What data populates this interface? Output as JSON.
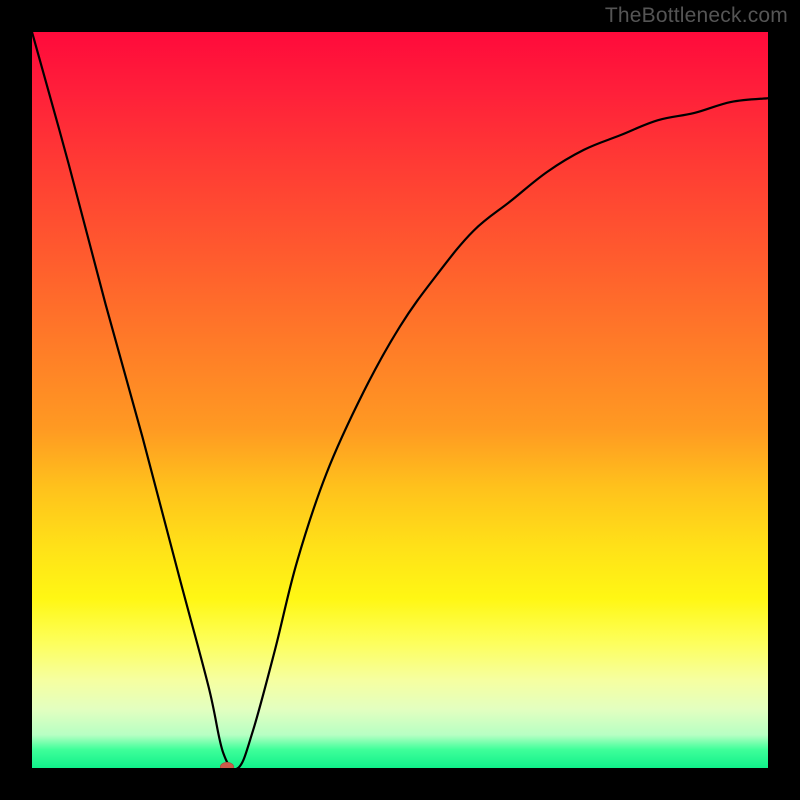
{
  "watermark": "TheBottleneck.com",
  "colors": {
    "background": "#000000",
    "curve": "#000000",
    "marker": "#cc5a4a"
  },
  "chart_data": {
    "type": "line",
    "title": "",
    "xlabel": "",
    "ylabel": "",
    "xlim": [
      0,
      100
    ],
    "ylim": [
      0,
      100
    ],
    "grid": false,
    "legend": false,
    "series": [
      {
        "name": "bottleneck-curve",
        "x": [
          0,
          5,
          10,
          15,
          20,
          24,
          26,
          28,
          30,
          33,
          36,
          40,
          45,
          50,
          55,
          60,
          65,
          70,
          75,
          80,
          85,
          90,
          95,
          100
        ],
        "y": [
          100,
          82,
          63,
          45,
          26,
          11,
          2,
          0,
          5,
          16,
          28,
          40,
          51,
          60,
          67,
          73,
          77,
          81,
          84,
          86,
          88,
          89,
          90.5,
          91
        ]
      }
    ],
    "markers": [
      {
        "name": "optimal-point",
        "x": 26.5,
        "y": 0
      }
    ],
    "annotations": [
      {
        "text": "TheBottleneck.com",
        "role": "watermark",
        "position": "top-right"
      }
    ]
  }
}
